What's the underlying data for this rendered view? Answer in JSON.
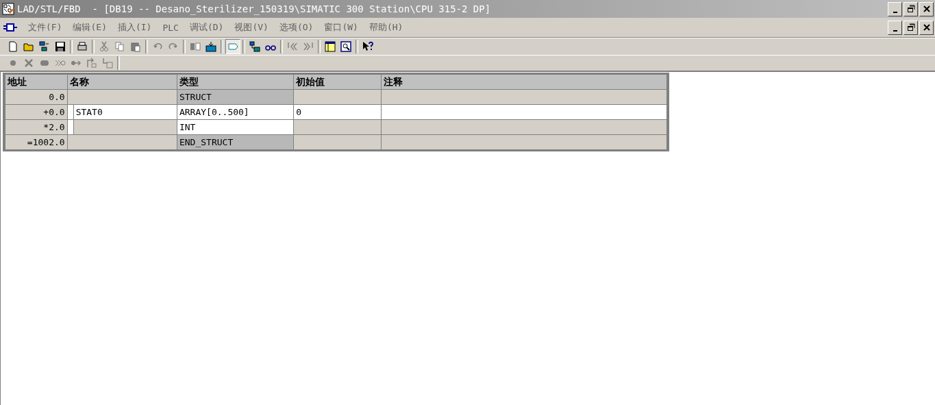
{
  "window": {
    "title": "LAD/STL/FBD  - [DB19 -- Desano_Sterilizer_150319\\SIMATIC 300 Station\\CPU 315-2 DP]"
  },
  "menu": [
    {
      "label": "文件(F)"
    },
    {
      "label": "编辑(E)"
    },
    {
      "label": "插入(I)"
    },
    {
      "label": "PLC"
    },
    {
      "label": "调试(D)"
    },
    {
      "label": "视图(V)"
    },
    {
      "label": "选项(O)"
    },
    {
      "label": "窗口(W)"
    },
    {
      "label": "帮助(H)"
    }
  ],
  "toolbar": [
    {
      "pressed": false
    },
    {
      "pressed": false
    },
    {
      "pressed": false
    },
    {
      "pressed": false
    },
    {
      "pressed": false
    },
    {
      "pressed": false
    },
    {
      "pressed": false
    },
    {
      "pressed": false
    },
    {
      "pressed": false
    },
    {
      "pressed": false
    },
    {
      "pressed": false
    },
    {
      "pressed": false
    },
    {
      "pressed": true
    },
    {
      "pressed": false
    },
    {
      "pressed": false
    },
    {
      "pressed": false
    },
    {
      "pressed": false
    },
    {
      "pressed": false
    },
    {
      "pressed": false
    },
    {
      "pressed": false
    }
  ],
  "toolbar_2": [
    {
      "disabled": true
    },
    {
      "disabled": true
    },
    {
      "disabled": true
    },
    {
      "disabled": true
    },
    {
      "disabled": true
    },
    {
      "disabled": true
    },
    {
      "disabled": true
    }
  ],
  "table": {
    "columns": [
      "地址",
      "名称",
      "类型",
      "初始值",
      "注释"
    ],
    "rows": [
      {
        "indented": false,
        "cells": [
          {
            "text": "0.0",
            "editable": false
          },
          {
            "editable": false
          },
          {
            "text": "STRUCT",
            "editable": false,
            "kind": "keyword"
          },
          {
            "editable": false
          },
          {
            "editable": false
          }
        ]
      },
      {
        "indented": true,
        "cells": [
          {
            "text": "+0.0",
            "editable": false
          },
          {
            "text": "STAT0",
            "editable": true
          },
          {
            "text": "ARRAY[0..500]",
            "editable": true
          },
          {
            "text": "0",
            "editable": true
          },
          {
            "editable": true
          }
        ]
      },
      {
        "indented": true,
        "cells": [
          {
            "text": "*2.0",
            "editable": false
          },
          {
            "editable": false
          },
          {
            "text": "INT",
            "editable": true
          },
          {
            "editable": false
          },
          {
            "editable": false
          }
        ]
      },
      {
        "indented": false,
        "cells": [
          {
            "text": "=1002.0",
            "editable": false
          },
          {
            "editable": false
          },
          {
            "text": "END_STRUCT",
            "editable": false,
            "kind": "keyword"
          },
          {
            "editable": false
          },
          {
            "editable": false
          }
        ]
      }
    ]
  }
}
